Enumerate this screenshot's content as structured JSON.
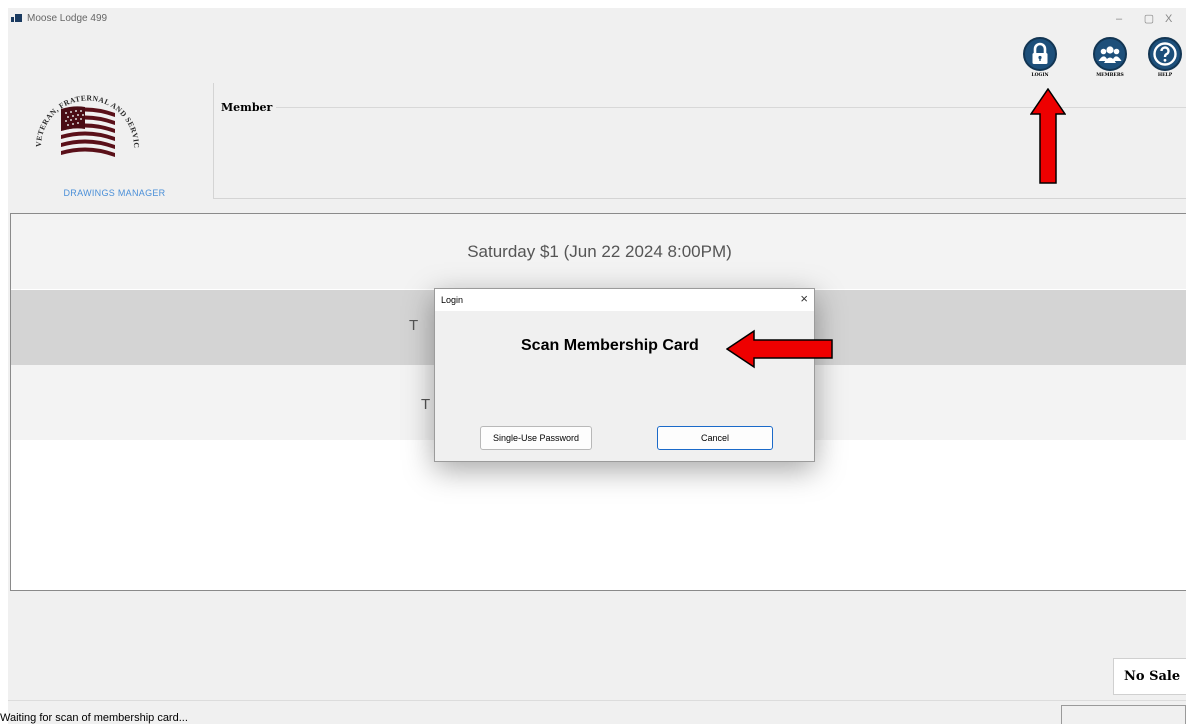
{
  "window": {
    "title": "Moose Lodge 499",
    "minimize": "–",
    "maximize": "▢",
    "close": "X"
  },
  "logo": {
    "ring_text": "VETERAN, FRATERNAL AND SERVICE ORGANIZATIONS",
    "caption": "DRAWINGS MANAGER"
  },
  "member": {
    "label": "Member"
  },
  "nav": {
    "login": "LOGIN",
    "members": "MEMBERS",
    "help": "HELP"
  },
  "drawing": {
    "title": "Saturday $1 (Jun 22 2024  8:00PM)",
    "row2_text": "T",
    "row3_text": "T"
  },
  "dialog": {
    "title": "Login",
    "close": "×",
    "message": "Scan Membership Card",
    "password_button": "Single-Use Password",
    "cancel_button": "Cancel"
  },
  "footer": {
    "no_sale": "No Sale",
    "status": "Waiting for scan of membership card..."
  },
  "colors": {
    "nav_icon": "#1d4f7a",
    "arrow": "#ee0000",
    "logo_caption": "#4a8fd8",
    "flag_red": "#5a1019"
  },
  "icons": {
    "login": "lock-icon",
    "members": "people-icon",
    "help": "question-icon"
  }
}
